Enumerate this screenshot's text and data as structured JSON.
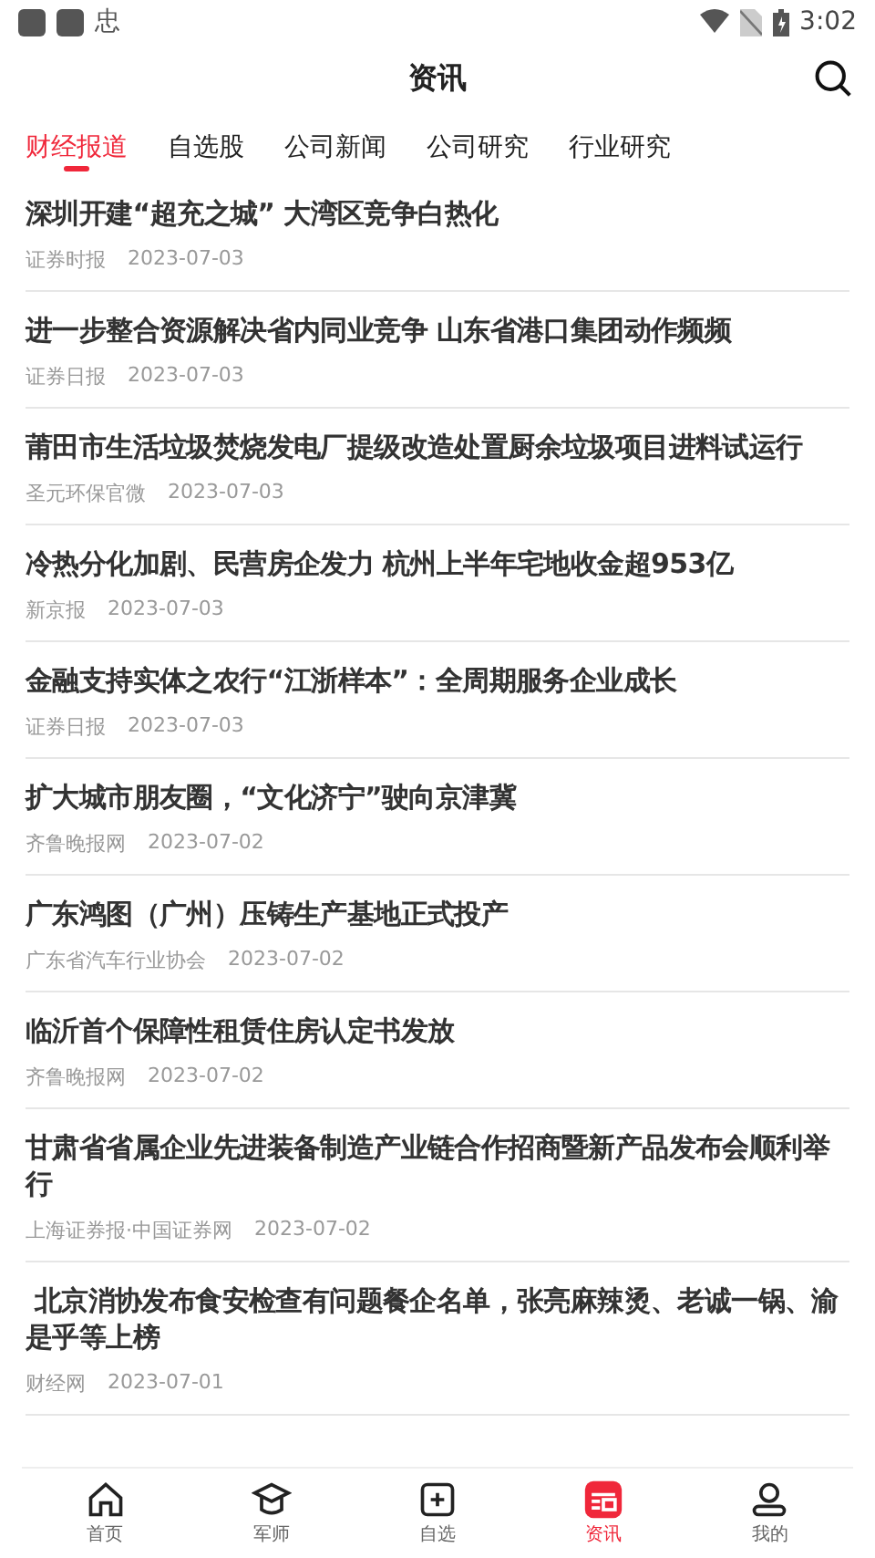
{
  "status_bar": {
    "notification_glyph": "忠",
    "time": "3:02"
  },
  "header": {
    "title": "资讯"
  },
  "tabs": [
    {
      "label": "财经报道",
      "selected": true
    },
    {
      "label": "自选股",
      "selected": false
    },
    {
      "label": "公司新闻",
      "selected": false
    },
    {
      "label": "公司研究",
      "selected": false
    },
    {
      "label": "行业研究",
      "selected": false
    }
  ],
  "articles": [
    {
      "title": "深圳开建“超充之城” 大湾区竞争白热化",
      "source": "证券时报",
      "date": "2023-07-03"
    },
    {
      "title": "进一步整合资源解决省内同业竞争 山东省港口集团动作频频",
      "source": "证券日报",
      "date": "2023-07-03"
    },
    {
      "title": "莆田市生活垃圾焚烧发电厂提级改造处置厨余垃圾项目进料试运行",
      "source": "圣元环保官微",
      "date": "2023-07-03"
    },
    {
      "title": "冷热分化加剧、民营房企发力 杭州上半年宅地收金超953亿",
      "source": "新京报",
      "date": "2023-07-03"
    },
    {
      "title": "金融支持实体之农行“江浙样本”：全周期服务企业成长",
      "source": "证券日报",
      "date": "2023-07-03"
    },
    {
      "title": "扩大城市朋友圈，“文化济宁”驶向京津冀",
      "source": "齐鲁晚报网",
      "date": "2023-07-02"
    },
    {
      "title": "广东鸿图（广州）压铸生产基地正式投产",
      "source": "广东省汽车行业协会",
      "date": "2023-07-02"
    },
    {
      "title": "临沂首个保障性租赁住房认定书发放",
      "source": "齐鲁晚报网",
      "date": "2023-07-02"
    },
    {
      "title": "甘肃省省属企业先进装备制造产业链合作招商暨新产品发布会顺利举行",
      "source": "上海证券报·中国证券网",
      "date": "2023-07-02"
    },
    {
      "title": " 北京消协发布食安检查有问题餐企名单，张亮麻辣烫、老诚一锅、渝是乎等上榜",
      "source": "财经网",
      "date": "2023-07-01"
    }
  ],
  "bottom_nav": [
    {
      "label": "首页",
      "kind": "home",
      "selected": false
    },
    {
      "label": "军师",
      "kind": "advisor",
      "selected": false
    },
    {
      "label": "自选",
      "kind": "watchlist",
      "selected": false
    },
    {
      "label": "资讯",
      "kind": "news",
      "selected": true
    },
    {
      "label": "我的",
      "kind": "profile",
      "selected": false
    }
  ]
}
